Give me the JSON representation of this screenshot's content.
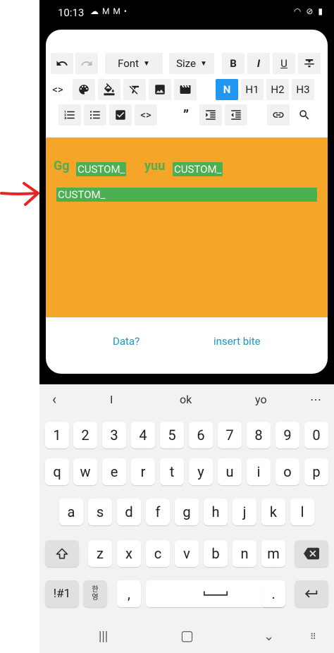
{
  "status": {
    "time": "10:13"
  },
  "toolbar": {
    "font_label": "Font",
    "size_label": "Size",
    "bold": "B",
    "italic": "I",
    "underline": "U",
    "normal": "N",
    "h1": "H1",
    "h2": "H2",
    "h3": "H3",
    "quote": "”",
    "code": "<>"
  },
  "editor": {
    "text1": "Gg",
    "tag1": "CUSTOM_",
    "text2": "yuu",
    "tag2": "CUSTOM_",
    "line2": "CUSTOM_",
    "background": "#f5a628",
    "highlight": "#4caf50"
  },
  "links": {
    "data": "Data?",
    "insert": "insert bite"
  },
  "keyboard": {
    "suggestions": [
      "I",
      "ok",
      "yo"
    ],
    "row_numbers": [
      "1",
      "2",
      "3",
      "4",
      "5",
      "6",
      "7",
      "8",
      "9",
      "0"
    ],
    "row1": [
      "q",
      "w",
      "e",
      "r",
      "t",
      "y",
      "u",
      "i",
      "o",
      "p"
    ],
    "row2": [
      "a",
      "s",
      "d",
      "f",
      "g",
      "h",
      "j",
      "k",
      "l"
    ],
    "row3": [
      "z",
      "x",
      "c",
      "v",
      "b",
      "n",
      "m"
    ],
    "symbols": "!#1",
    "lang_top": "한",
    "lang_bottom": "영",
    "comma": ",",
    "period": "."
  }
}
